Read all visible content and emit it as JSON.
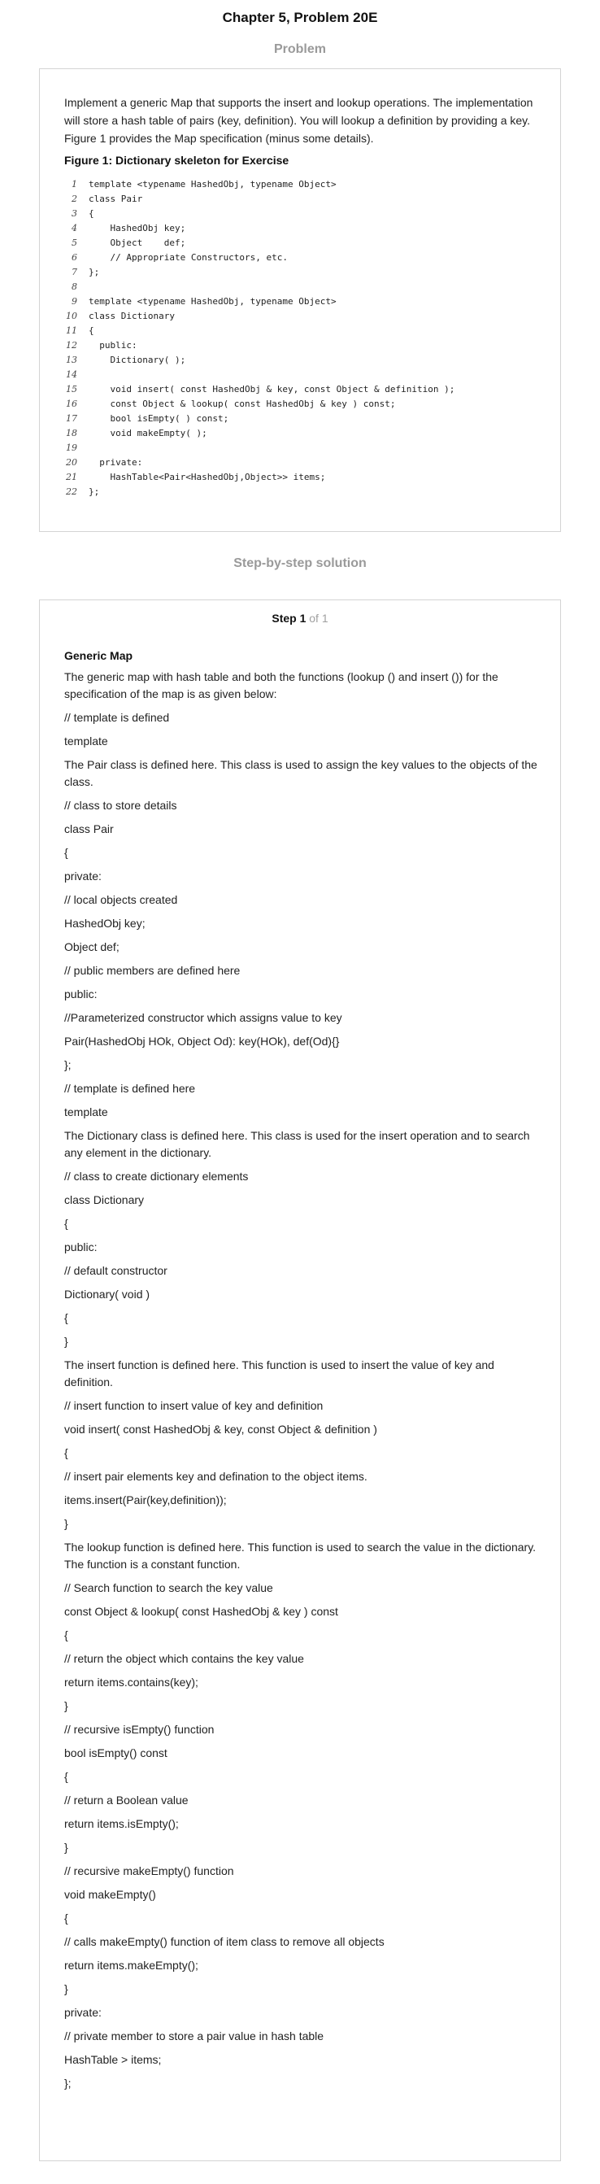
{
  "page_title": "Chapter 5, Problem 20E",
  "problem": {
    "heading": "Problem",
    "text": "Implement a generic Map that supports the insert and lookup operations. The implementation will store a hash table of pairs (key, definition). You will lookup a definition by providing a key. Figure 1 provides the Map specification (minus some details).",
    "figure_caption": "Figure 1: Dictionary skeleton for Exercise",
    "code": [
      {
        "n": "1",
        "text": "template <typename HashedObj, typename Object>"
      },
      {
        "n": "2",
        "text": "class Pair"
      },
      {
        "n": "3",
        "text": "{"
      },
      {
        "n": "4",
        "text": "    HashedObj key;"
      },
      {
        "n": "5",
        "text": "    Object    def;"
      },
      {
        "n": "6",
        "text": "    // Appropriate Constructors, etc."
      },
      {
        "n": "7",
        "text": "};"
      },
      {
        "n": "8",
        "text": ""
      },
      {
        "n": "9",
        "text": "template <typename HashedObj, typename Object>"
      },
      {
        "n": "10",
        "text": "class Dictionary"
      },
      {
        "n": "11",
        "text": "{"
      },
      {
        "n": "12",
        "text": "  public:"
      },
      {
        "n": "13",
        "text": "    Dictionary( );"
      },
      {
        "n": "14",
        "text": ""
      },
      {
        "n": "15",
        "text": "    void insert( const HashedObj & key, const Object & definition );"
      },
      {
        "n": "16",
        "text": "    const Object & lookup( const HashedObj & key ) const;"
      },
      {
        "n": "17",
        "text": "    bool isEmpty( ) const;"
      },
      {
        "n": "18",
        "text": "    void makeEmpty( );"
      },
      {
        "n": "19",
        "text": ""
      },
      {
        "n": "20",
        "text": "  private:"
      },
      {
        "n": "21",
        "text": "    HashTable<Pair<HashedObj,Object>> items;"
      },
      {
        "n": "22",
        "text": "};"
      }
    ]
  },
  "solution": {
    "heading": "Step-by-step solution",
    "step_label": "Step 1",
    "step_of": "of 1",
    "title": "Generic Map",
    "lines": [
      "The generic map with hash table and both the functions (lookup () and insert ()) for the specification of the map is as given below:",
      "// template is defined",
      "template",
      "The Pair class is defined here. This class is used to assign the key values to the objects of the class.",
      "// class to store details",
      "class Pair",
      "{",
      "private:",
      "// local objects created",
      "HashedObj key;",
      "Object def;",
      "// public members are defined here",
      "public:",
      "//Parameterized constructor which assigns value to key",
      "Pair(HashedObj HOk, Object Od): key(HOk), def(Od){}",
      "};",
      "// template is defined here",
      "template",
      "The Dictionary class is defined here. This class is used for the insert operation and to search any element in the dictionary.",
      "// class to create dictionary elements",
      "class Dictionary",
      "{",
      "public:",
      "// default constructor",
      "Dictionary( void )",
      "{",
      "}",
      "The insert function is defined here. This function is used to insert the value of key and definition.",
      "// insert function to insert value of key and definition",
      "void insert( const HashedObj & key, const Object & definition )",
      "{",
      "// insert pair elements key and defination to the object items.",
      "items.insert(Pair(key,definition));",
      "}",
      "The lookup function is defined here. This function is used to search the value in the dictionary. The function is a constant function.",
      "// Search function to search the key value",
      "const Object & lookup( const HashedObj & key ) const",
      "{",
      "// return the object which contains the key value",
      "return items.contains(key);",
      "}",
      "// recursive isEmpty() function",
      "bool isEmpty() const",
      "{",
      "// return a Boolean value",
      "return items.isEmpty();",
      "}",
      "// recursive makeEmpty() function",
      "void makeEmpty()",
      "{",
      "// calls makeEmpty() function of item class to remove all objects",
      "return items.makeEmpty();",
      "}",
      "private:",
      "// private member to store a pair value in hash table",
      "HashTable > items;",
      "};"
    ]
  }
}
